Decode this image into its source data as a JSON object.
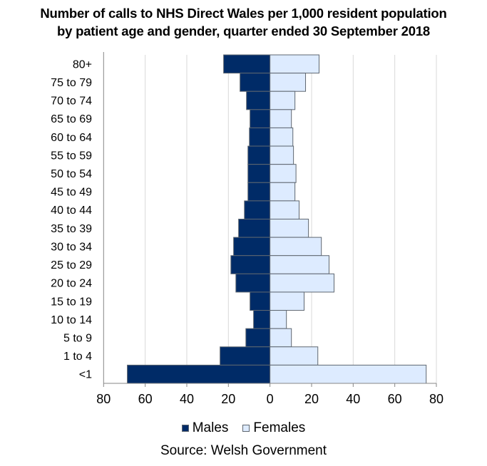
{
  "chart_data": {
    "type": "bar",
    "orientation": "horizontal-population-pyramid",
    "title": "Number of calls to NHS  Direct Wales per 1,000 resident population by patient age and gender, quarter ended 30 September 2018",
    "title_lines": [
      "Number of calls to NHS  Direct Wales per 1,000 resident population",
      "by patient age and gender, quarter ended 30 September 2018"
    ],
    "xlabel": "",
    "ylabel": "",
    "categories": [
      "80+",
      "75 to 79",
      "70 to 74",
      "65 to 69",
      "60 to 64",
      "55 to 59",
      "50 to 54",
      "45 to 49",
      "40 to 44",
      "35 to 39",
      "30 to 34",
      "25 to 29",
      "20 to 24",
      "15 to 19",
      "10 to 14",
      "5 to 9",
      "1 to 4",
      "<1"
    ],
    "series": [
      {
        "name": "Males",
        "color": "#002b67",
        "side": "left",
        "values": [
          22.3,
          14.4,
          11.3,
          9.6,
          9.9,
          10.6,
          10.6,
          10.6,
          12.3,
          15.1,
          17.5,
          18.8,
          16.4,
          9.6,
          7.9,
          11.6,
          24.0,
          68.6
        ]
      },
      {
        "name": "Females",
        "color": "#ddebff",
        "side": "right",
        "values": [
          23.6,
          17.1,
          12.0,
          10.3,
          11.0,
          11.3,
          12.5,
          12.0,
          14.0,
          18.5,
          24.7,
          28.4,
          30.8,
          16.4,
          7.9,
          10.3,
          23.0,
          75.1
        ]
      }
    ],
    "xlim": [
      -80,
      80
    ],
    "x_ticks": [
      -80,
      -60,
      -40,
      -20,
      0,
      20,
      40,
      60,
      80
    ],
    "x_tick_labels": [
      "80",
      "60",
      "40",
      "20",
      "0",
      "20",
      "40",
      "60",
      "80"
    ],
    "grid": true,
    "legend": {
      "placement": "bottom",
      "entries": [
        "Males",
        "Females"
      ]
    },
    "source": "Source: Welsh Government"
  },
  "colors": {
    "males": "#002b67",
    "females": "#ddebff",
    "bar_border": "#5f6770",
    "grid": "#d9d9d9",
    "axis": "#868686"
  }
}
